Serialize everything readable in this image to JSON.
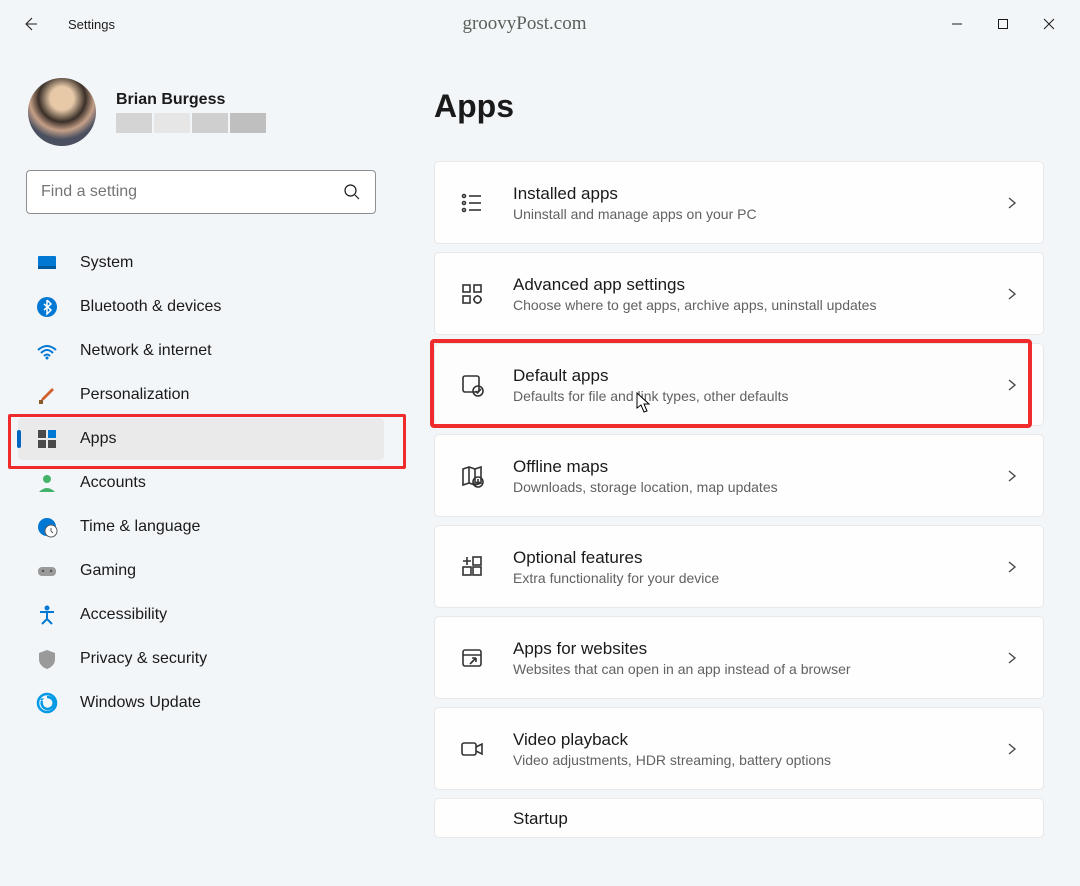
{
  "window": {
    "title": "Settings"
  },
  "watermark": "groovyPost.com",
  "profile": {
    "name": "Brian Burgess"
  },
  "search": {
    "placeholder": "Find a setting"
  },
  "sidebar": {
    "items": [
      {
        "id": "system",
        "label": "System"
      },
      {
        "id": "bluetooth",
        "label": "Bluetooth & devices"
      },
      {
        "id": "network",
        "label": "Network & internet"
      },
      {
        "id": "personalization",
        "label": "Personalization"
      },
      {
        "id": "apps",
        "label": "Apps"
      },
      {
        "id": "accounts",
        "label": "Accounts"
      },
      {
        "id": "time",
        "label": "Time & language"
      },
      {
        "id": "gaming",
        "label": "Gaming"
      },
      {
        "id": "accessibility",
        "label": "Accessibility"
      },
      {
        "id": "privacy",
        "label": "Privacy & security"
      },
      {
        "id": "update",
        "label": "Windows Update"
      }
    ],
    "selected_index": 4,
    "highlighted_index": 4
  },
  "main": {
    "title": "Apps",
    "cards": [
      {
        "id": "installed",
        "title": "Installed apps",
        "sub": "Uninstall and manage apps on your PC"
      },
      {
        "id": "advanced",
        "title": "Advanced app settings",
        "sub": "Choose where to get apps, archive apps, uninstall updates"
      },
      {
        "id": "default",
        "title": "Default apps",
        "sub": "Defaults for file and link types, other defaults"
      },
      {
        "id": "offline",
        "title": "Offline maps",
        "sub": "Downloads, storage location, map updates"
      },
      {
        "id": "optional",
        "title": "Optional features",
        "sub": "Extra functionality for your device"
      },
      {
        "id": "aws",
        "title": "Apps for websites",
        "sub": "Websites that can open in an app instead of a browser"
      },
      {
        "id": "video",
        "title": "Video playback",
        "sub": "Video adjustments, HDR streaming, battery options"
      }
    ],
    "partial": {
      "title": "Startup"
    },
    "highlighted_index": 2
  }
}
